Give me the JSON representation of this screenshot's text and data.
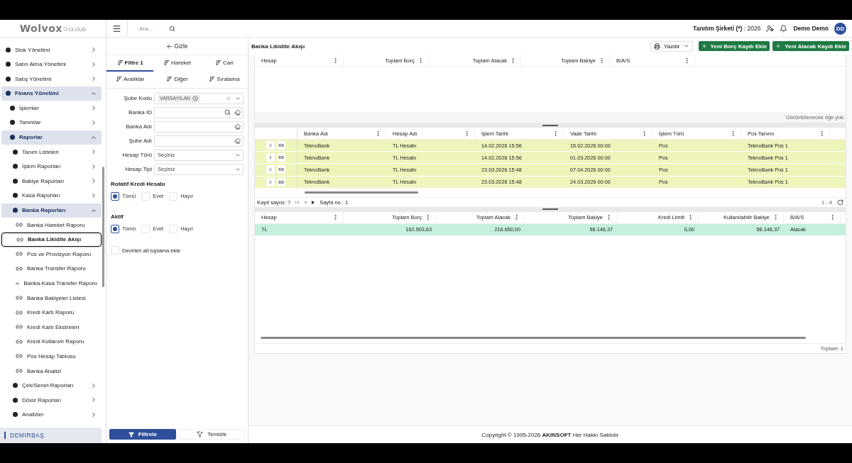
{
  "logo": {
    "text": "Wolvox",
    "sub": "CLOUD"
  },
  "header": {
    "search_placeholder": "Ara...",
    "company": "Tanıtım Şirketi (*)",
    "year": ": 2026",
    "user": "Demo Demo",
    "avatar": "DD"
  },
  "sidebar": {
    "items": [
      {
        "label": "Stok Yönetimi",
        "kind": "group",
        "expanded": false
      },
      {
        "label": "Satın Alma Yönetimi",
        "kind": "group",
        "expanded": false
      },
      {
        "label": "Satış Yönetimi",
        "kind": "group",
        "expanded": false
      },
      {
        "label": "Finans Yönetimi",
        "kind": "group",
        "expanded": true,
        "children": [
          {
            "label": "İşlemler",
            "kind": "group",
            "expanded": false
          },
          {
            "label": "Tanımlar",
            "kind": "group",
            "expanded": false
          },
          {
            "label": "Raporlar",
            "kind": "group",
            "expanded": true,
            "children": [
              {
                "label": "Tanım Listeleri",
                "kind": "group",
                "expanded": false
              },
              {
                "label": "İşlem Raporları",
                "kind": "group",
                "expanded": false
              },
              {
                "label": "Bakiye Raporları",
                "kind": "group",
                "expanded": false
              },
              {
                "label": "Kasa Raporları",
                "kind": "group",
                "expanded": false
              },
              {
                "label": "Banka Raporları",
                "kind": "group",
                "expanded": true,
                "children": [
                  {
                    "label": "Banka Hareket Raporu",
                    "kind": "link",
                    "selected": false
                  },
                  {
                    "label": "Banka Likidite Akışı",
                    "kind": "link",
                    "selected": true
                  },
                  {
                    "label": "Pos ve Provizyon Raporu",
                    "kind": "link",
                    "selected": false
                  },
                  {
                    "label": "Banka Transfer Raporu",
                    "kind": "link",
                    "selected": false
                  },
                  {
                    "label": "Banka-Kasa Transfer Raporu",
                    "kind": "link",
                    "selected": false
                  },
                  {
                    "label": "Banka Bakiyeler Listesi",
                    "kind": "link",
                    "selected": false
                  },
                  {
                    "label": "Kredi Kartı Raporu",
                    "kind": "link",
                    "selected": false
                  },
                  {
                    "label": "Kredi Kartı Ekstreleri",
                    "kind": "link",
                    "selected": false
                  },
                  {
                    "label": "Kredi Kullanım Raporu",
                    "kind": "link",
                    "selected": false
                  },
                  {
                    "label": "Pos Hesap Tablosu",
                    "kind": "link",
                    "selected": false
                  },
                  {
                    "label": "Banka Analizi",
                    "kind": "link",
                    "selected": false
                  }
                ]
              },
              {
                "label": "Çek/Senet Raporları",
                "kind": "group",
                "expanded": false
              },
              {
                "label": "Döviz Raporları",
                "kind": "group",
                "expanded": false
              },
              {
                "label": "Analizler",
                "kind": "group",
                "expanded": false
              }
            ]
          }
        ]
      }
    ],
    "footer_item": "DEMIRBAŞ"
  },
  "filter": {
    "hide": "Gizle",
    "tabs": [
      {
        "label": "Filtre 1",
        "selected": true
      },
      {
        "label": "Hareket",
        "selected": false
      },
      {
        "label": "Cari",
        "selected": false
      },
      {
        "label": "Aralıklar",
        "selected": false
      },
      {
        "label": "Diğer",
        "selected": false
      },
      {
        "label": "Sıralama",
        "selected": false
      }
    ],
    "fields": [
      {
        "label": "Şube Kodu",
        "kind": "tag",
        "value": "VARSAYILAN"
      },
      {
        "label": "Banka ID",
        "kind": "search"
      },
      {
        "label": "Banka Adı",
        "kind": "text"
      },
      {
        "label": "Şube Adı",
        "kind": "text"
      },
      {
        "label": "Hesap Türü",
        "kind": "select",
        "value": "Seçiniz"
      },
      {
        "label": "Hesap Tipi",
        "kind": "select",
        "value": "Seçiniz"
      }
    ],
    "radio_groups": [
      {
        "title": "Rotatif Kredi Hesabı",
        "options": [
          {
            "label": "Tümü",
            "selected": true
          },
          {
            "label": "Evet",
            "selected": false
          },
          {
            "label": "Hayır",
            "selected": false
          }
        ]
      },
      {
        "title": "Aktif",
        "options": [
          {
            "label": "Tümü",
            "selected": true
          },
          {
            "label": "Evet",
            "selected": false
          },
          {
            "label": "Hayır",
            "selected": false
          }
        ]
      }
    ],
    "checkbox": {
      "label": "Devirleri alt toplama ekle",
      "checked": false
    },
    "apply": "Filtrele",
    "clear": "Temizle"
  },
  "main": {
    "title": "Banka Likidite Akışı",
    "print": "Yazdır",
    "add_debit": "Yeni Borç Kaydı Ekle",
    "add_credit": "Yeni Alacak Kaydı Ekle",
    "summary_table": {
      "columns": [
        {
          "label": "Hesap",
          "numeric": false
        },
        {
          "label": "Toplam Borç",
          "numeric": true
        },
        {
          "label": "Toplam Alacak",
          "numeric": true
        },
        {
          "label": "Toplam Bakiye",
          "numeric": true
        },
        {
          "label": "B/A/S",
          "numeric": false
        }
      ],
      "empty": "Görüntülenecek öğe yok"
    },
    "detail_table": {
      "columns": [
        "Banka Adı",
        "Hesap Adı",
        "İşlem Tarihi",
        "Vade Tarihi",
        "İşlem Türü",
        "Pos Tanımı"
      ],
      "rows": [
        {
          "cells": [
            "TeknoBank",
            "TL Hesabı",
            "14.02.2026 15:56",
            "15.02.2026 00:00",
            "Pos",
            "TeknoBank Pos 1"
          ]
        },
        {
          "cells": [
            "TeknoBank",
            "TL Hesabı",
            "14.02.2026 15:56",
            "01.03.2026 00:00",
            "Pos",
            "TeknoBank Pos 1"
          ]
        },
        {
          "cells": [
            "TeknoBank",
            "TL Hesabı",
            "23.03.2026 15:48",
            "07.04.2026 00:00",
            "Pos",
            "TeknoBank Pos 1"
          ]
        },
        {
          "cells": [
            "TeknoBank",
            "TL Hesabı",
            "23.03.2026 15:48",
            "24.03.2026 00:00",
            "Pos",
            "TeknoBank Pos 1"
          ]
        }
      ],
      "pager": {
        "count_label": "Kayıt sayısı:",
        "count": "?",
        "page_label": "Sayfa no :",
        "page": "1",
        "range": "1 - 4"
      }
    },
    "balance_table": {
      "columns": [
        {
          "label": "Hesap",
          "numeric": false
        },
        {
          "label": "Toplam Borç",
          "numeric": true
        },
        {
          "label": "Toplam Alacak",
          "numeric": true
        },
        {
          "label": "Toplam Bakiye",
          "numeric": true
        },
        {
          "label": "Kredi Limiti",
          "numeric": true
        },
        {
          "label": "Kullanılabilir Bakiye",
          "numeric": true
        },
        {
          "label": "B/A/S",
          "numeric": false
        }
      ],
      "rows": [
        {
          "cells": [
            "TL",
            "162.503,63",
            "218.650,00",
            "56.146,37",
            "0,00",
            "56.146,37",
            "Alacak"
          ]
        }
      ],
      "total": "Toplam: 1"
    }
  },
  "footer": "Copyright © 1995-2026 **AKINSOFT** Her Hakkı Saklıdır"
}
